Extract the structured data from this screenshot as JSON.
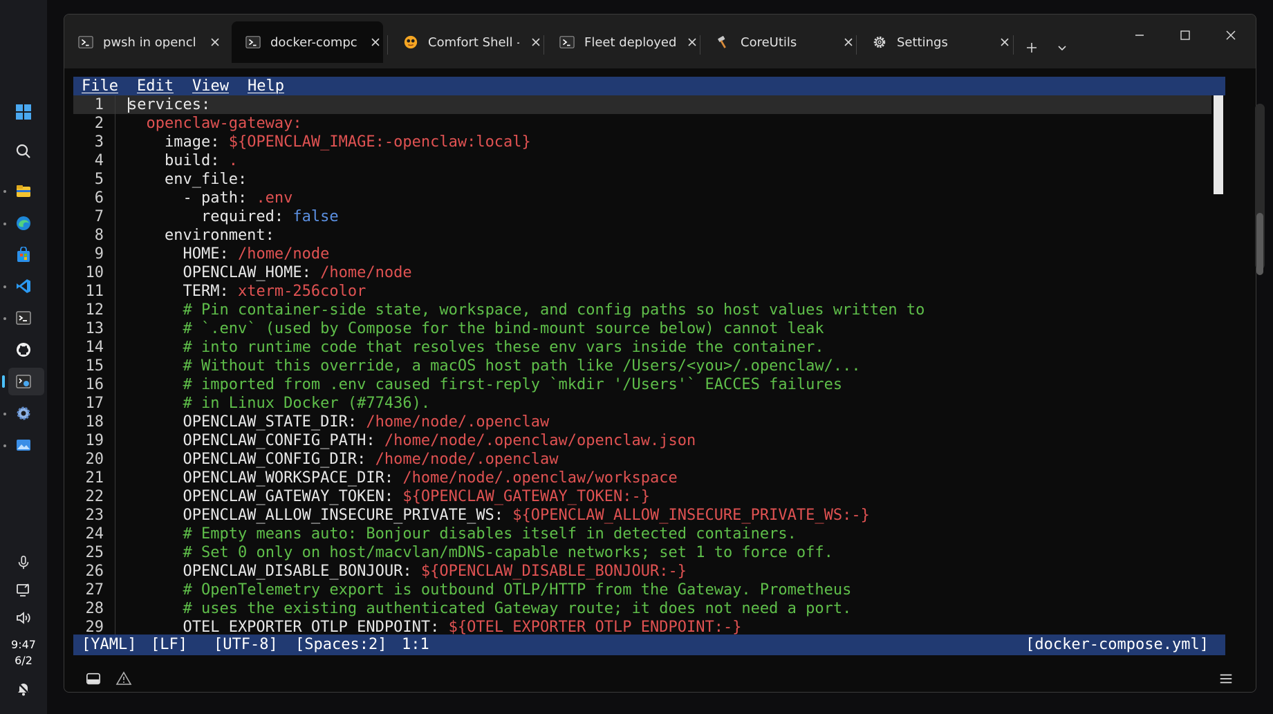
{
  "taskbar": {
    "icons": [
      "windows-start-icon",
      "search-icon",
      "file-explorer-icon",
      "edge-icon",
      "store-icon",
      "vscode-icon",
      "terminal-icon",
      "github-icon",
      "terminal-preview-icon",
      "settings-icon",
      "photos-icon"
    ],
    "tray": [
      "microphone-icon",
      "display-icon",
      "volume-icon",
      "notification-icon"
    ],
    "time": "9:47",
    "date": "6/2"
  },
  "tabs": [
    {
      "title": "pwsh in opencl",
      "icon": "powershell-icon",
      "active": false
    },
    {
      "title": "docker-compc",
      "icon": "powershell-icon",
      "active": true
    },
    {
      "title": "Comfort Shell -",
      "icon": "comfort-shell-icon",
      "active": false
    },
    {
      "title": "Fleet deployed",
      "icon": "powershell-icon",
      "active": false
    },
    {
      "title": "CoreUtils",
      "icon": "hammer-icon",
      "active": false
    },
    {
      "title": "Settings",
      "icon": "gear-icon",
      "active": false
    }
  ],
  "menu": [
    "File",
    "Edit",
    "View",
    "Help"
  ],
  "editor": {
    "lines": [
      [
        {
          "t": "services:",
          "c": "k"
        }
      ],
      [
        {
          "t": "  "
        },
        {
          "t": "openclaw-gateway:",
          "c": "s"
        }
      ],
      [
        {
          "t": "    image: ",
          "c": "k"
        },
        {
          "t": "${OPENCLAW_IMAGE:-openclaw:local}",
          "c": "s"
        }
      ],
      [
        {
          "t": "    build: ",
          "c": "k"
        },
        {
          "t": ".",
          "c": "s"
        }
      ],
      [
        {
          "t": "    env_file:",
          "c": "k"
        }
      ],
      [
        {
          "t": "      - path: ",
          "c": "k"
        },
        {
          "t": ".env",
          "c": "s"
        }
      ],
      [
        {
          "t": "        required: ",
          "c": "k"
        },
        {
          "t": "false",
          "c": "b"
        }
      ],
      [
        {
          "t": "    environment:",
          "c": "k"
        }
      ],
      [
        {
          "t": "      HOME: ",
          "c": "k"
        },
        {
          "t": "/home/node",
          "c": "s"
        }
      ],
      [
        {
          "t": "      OPENCLAW_HOME: ",
          "c": "k"
        },
        {
          "t": "/home/node",
          "c": "s"
        }
      ],
      [
        {
          "t": "      TERM: ",
          "c": "k"
        },
        {
          "t": "xterm-256color",
          "c": "s"
        }
      ],
      [
        {
          "t": "      "
        },
        {
          "t": "# Pin container-side state, workspace, and config paths so host values written to",
          "c": "c"
        }
      ],
      [
        {
          "t": "      "
        },
        {
          "t": "# `.env` (used by Compose for the bind-mount source below) cannot leak",
          "c": "c"
        }
      ],
      [
        {
          "t": "      "
        },
        {
          "t": "# into runtime code that resolves these env vars inside the container.",
          "c": "c"
        }
      ],
      [
        {
          "t": "      "
        },
        {
          "t": "# Without this override, a macOS host path like /Users/<you>/.openclaw/...",
          "c": "c"
        }
      ],
      [
        {
          "t": "      "
        },
        {
          "t": "# imported from .env caused first-reply `mkdir '/Users'` EACCES failures",
          "c": "c"
        }
      ],
      [
        {
          "t": "      "
        },
        {
          "t": "# in Linux Docker (#77436).",
          "c": "c"
        }
      ],
      [
        {
          "t": "      OPENCLAW_STATE_DIR: ",
          "c": "k"
        },
        {
          "t": "/home/node/.openclaw",
          "c": "s"
        }
      ],
      [
        {
          "t": "      OPENCLAW_CONFIG_PATH: ",
          "c": "k"
        },
        {
          "t": "/home/node/.openclaw/openclaw.json",
          "c": "s"
        }
      ],
      [
        {
          "t": "      OPENCLAW_CONFIG_DIR: ",
          "c": "k"
        },
        {
          "t": "/home/node/.openclaw",
          "c": "s"
        }
      ],
      [
        {
          "t": "      OPENCLAW_WORKSPACE_DIR: ",
          "c": "k"
        },
        {
          "t": "/home/node/.openclaw/workspace",
          "c": "s"
        }
      ],
      [
        {
          "t": "      OPENCLAW_GATEWAY_TOKEN: ",
          "c": "k"
        },
        {
          "t": "${OPENCLAW_GATEWAY_TOKEN:-}",
          "c": "s"
        }
      ],
      [
        {
          "t": "      OPENCLAW_ALLOW_INSECURE_PRIVATE_WS: ",
          "c": "k"
        },
        {
          "t": "${OPENCLAW_ALLOW_INSECURE_PRIVATE_WS:-}",
          "c": "s"
        }
      ],
      [
        {
          "t": "      "
        },
        {
          "t": "# Empty means auto: Bonjour disables itself in detected containers.",
          "c": "c"
        }
      ],
      [
        {
          "t": "      "
        },
        {
          "t": "# Set 0 only on host/macvlan/mDNS-capable networks; set 1 to force off.",
          "c": "c"
        }
      ],
      [
        {
          "t": "      OPENCLAW_DISABLE_BONJOUR: ",
          "c": "k"
        },
        {
          "t": "${OPENCLAW_DISABLE_BONJOUR:-}",
          "c": "s"
        }
      ],
      [
        {
          "t": "      "
        },
        {
          "t": "# OpenTelemetry export is outbound OTLP/HTTP from the Gateway. Prometheus",
          "c": "c"
        }
      ],
      [
        {
          "t": "      "
        },
        {
          "t": "# uses the existing authenticated Gateway route; it does not need a port.",
          "c": "c"
        }
      ],
      [
        {
          "t": "      OTEL_EXPORTER_OTLP_ENDPOINT: ",
          "c": "k"
        },
        {
          "t": "${OTEL_EXPORTER_OTLP_ENDPOINT:-}",
          "c": "s"
        }
      ]
    ]
  },
  "status": {
    "language": "[YAML]",
    "eol": "[LF]",
    "encoding": "[UTF-8]",
    "indent": "[Spaces:2]",
    "position": "1:1",
    "filename": "[docker-compose.yml]"
  },
  "colors": {
    "accent": "#213a72",
    "string": "#e05252",
    "comment": "#5fbf4a",
    "boolean": "#5b8fe0",
    "text": "#e6e6e6"
  }
}
